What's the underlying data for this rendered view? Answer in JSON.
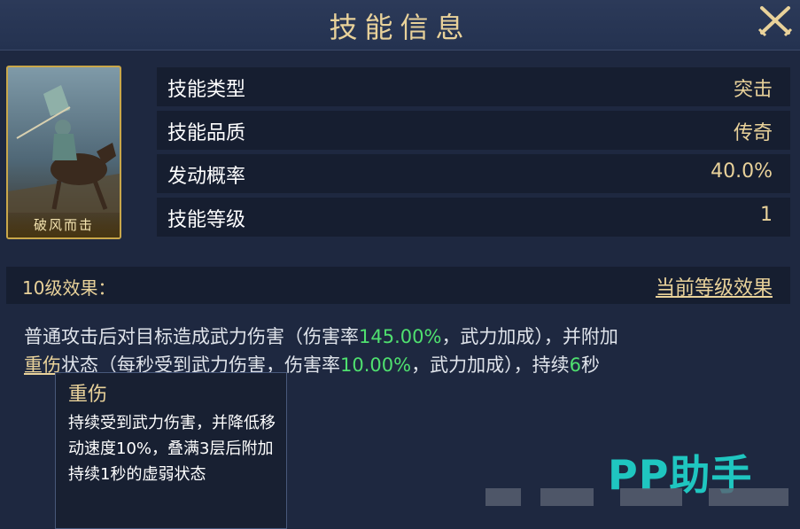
{
  "header": {
    "title": "技能信息"
  },
  "skill_card": {
    "name": "破风而击"
  },
  "info_rows": [
    {
      "label": "技能类型",
      "value": "突击"
    },
    {
      "label": "技能品质",
      "value": "传奇"
    },
    {
      "label": "发动概率",
      "value": "40.0%"
    },
    {
      "label": "技能等级",
      "value": "1"
    }
  ],
  "effect": {
    "level_label": "10级效果：",
    "current_link": "当前等级效果",
    "text": {
      "part1": "普通攻击后对目标造成武力伤害（伤害率",
      "rate1": "145.00%",
      "part2": "，武力加成），并附加",
      "keyword": "重伤",
      "part3": "状态（每秒受到武力伤害，伤害率",
      "rate2": "10.00%",
      "part4": "，武力加成），持续",
      "duration": "6",
      "part5": "秒"
    }
  },
  "tooltip": {
    "title": "重伤",
    "body": "持续受到武力伤害，并降低移动速度10%，叠满3层后附加持续1秒的虚弱状态"
  },
  "watermark": {
    "text": "PP助手"
  },
  "colors": {
    "gold": "#e9d29a",
    "highlight": "#4fe06f",
    "background": "#1e2840",
    "row": "#161e30"
  },
  "icons": {
    "close": "close-crossed-swords-icon"
  }
}
